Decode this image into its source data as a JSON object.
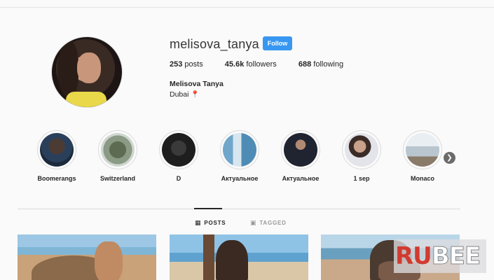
{
  "profile": {
    "username": "melisova_tanya",
    "follow_label": "Follow",
    "posts_count": "253",
    "posts_label": "posts",
    "followers_count": "45.6k",
    "followers_label": "followers",
    "following_count": "688",
    "following_label": "following",
    "full_name": "Melisova Tanya",
    "bio": "Dubai",
    "bio_icon": "pin-icon"
  },
  "highlights": [
    {
      "label": "Boomerangs"
    },
    {
      "label": "Switzerland"
    },
    {
      "label": "D"
    },
    {
      "label": "Актуальное"
    },
    {
      "label": "Актуальное"
    },
    {
      "label": "1 sep"
    },
    {
      "label": "Monaco"
    }
  ],
  "tabs": {
    "posts_label": "POSTS",
    "tagged_label": "TAGGED"
  },
  "watermark": {
    "part_a": "RU",
    "part_b": "BEE"
  },
  "colors": {
    "follow_button": "#3897f0",
    "background": "#fafafa"
  }
}
